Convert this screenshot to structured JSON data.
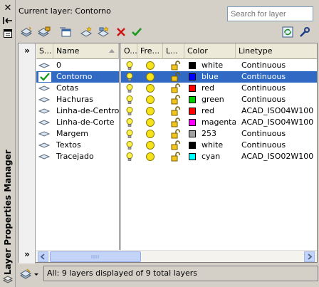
{
  "window": {
    "title": "Layer Properties Manager"
  },
  "header": {
    "current_layer": "Current layer: Contorno",
    "search_placeholder": "Search for layer"
  },
  "columns": [
    "S...",
    "Name",
    "O...",
    "Fre...",
    "L...",
    "Color",
    "Linetype"
  ],
  "layers": [
    {
      "name": "0",
      "status": "layer",
      "on": true,
      "frozen": false,
      "locked": false,
      "color_name": "white",
      "color_hex": "#000000",
      "linetype": "Continuous"
    },
    {
      "name": "Contorno",
      "status": "current",
      "on": true,
      "frozen": false,
      "locked": false,
      "color_name": "blue",
      "color_hex": "#0000ff",
      "linetype": "Continuous"
    },
    {
      "name": "Cotas",
      "status": "layer",
      "on": true,
      "frozen": false,
      "locked": false,
      "color_name": "red",
      "color_hex": "#ff0000",
      "linetype": "Continuous"
    },
    {
      "name": "Hachuras",
      "status": "layer",
      "on": true,
      "frozen": false,
      "locked": false,
      "color_name": "green",
      "color_hex": "#00cc00",
      "linetype": "Continuous"
    },
    {
      "name": "Linha-de-Centro",
      "status": "layer",
      "on": true,
      "frozen": false,
      "locked": false,
      "color_name": "red",
      "color_hex": "#ff0000",
      "linetype": "ACAD_ISO04W100"
    },
    {
      "name": "Linha-de-Corte",
      "status": "layer",
      "on": true,
      "frozen": false,
      "locked": false,
      "color_name": "magenta",
      "color_hex": "#ff00ff",
      "linetype": "ACAD_ISO04W100"
    },
    {
      "name": "Margem",
      "status": "layer",
      "on": true,
      "frozen": false,
      "locked": false,
      "color_name": "253",
      "color_hex": "#a0a0a0",
      "linetype": "Continuous"
    },
    {
      "name": "Textos",
      "status": "layer",
      "on": true,
      "frozen": false,
      "locked": false,
      "color_name": "white",
      "color_hex": "#000000",
      "linetype": "Continuous"
    },
    {
      "name": "Tracejado",
      "status": "layer",
      "on": true,
      "frozen": false,
      "locked": false,
      "color_name": "cyan",
      "color_hex": "#00ffff",
      "linetype": "ACAD_ISO02W100"
    }
  ],
  "selected_index": 1,
  "status_bar": {
    "text": "All: 9 layers displayed of 9 total layers"
  },
  "colors": {
    "selection": "#316ac5",
    "panel": "#d4d0c8",
    "current_check": "#1a9a1a"
  },
  "toolbar_icons": [
    "new-property-filter-icon",
    "new-group-filter-icon",
    "layer-states-manager-icon",
    "new-layer-icon",
    "new-layer-vp-frozen-icon",
    "delete-layer-icon",
    "set-current-icon",
    "refresh-icon",
    "settings-icon"
  ]
}
